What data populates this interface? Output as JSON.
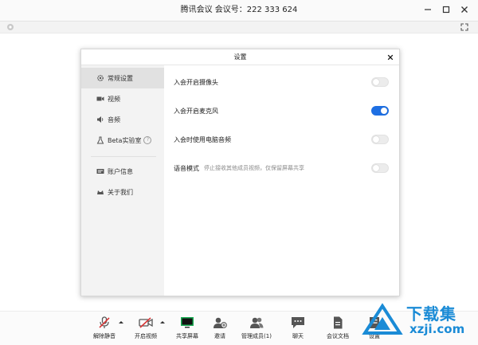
{
  "window": {
    "title": "腾讯会议  会议号：222 333 624"
  },
  "dialog": {
    "title": "设置",
    "nav": [
      {
        "label": "常规设置",
        "icon": "gear-icon"
      },
      {
        "label": "视频",
        "icon": "video-camera-icon"
      },
      {
        "label": "音频",
        "icon": "speaker-icon"
      },
      {
        "label": "Beta实验室",
        "icon": "flask-icon"
      },
      {
        "label": "账户信息",
        "icon": "id-card-icon"
      },
      {
        "label": "关于我们",
        "icon": "cat-icon"
      }
    ],
    "settings": [
      {
        "label": "入会开启摄像头",
        "note": "",
        "on": false
      },
      {
        "label": "入会开启麦克风",
        "note": "",
        "on": true
      },
      {
        "label": "入会时使用电脑音频",
        "note": "",
        "on": false
      },
      {
        "label": "语音模式",
        "note": "停止接收其他成员视频，仅保留屏幕共享",
        "on": false
      }
    ]
  },
  "bottom_toolbar": [
    {
      "label": "解除静音",
      "icon": "microphone-muted-icon"
    },
    {
      "label": "开启视频",
      "icon": "video-off-icon"
    },
    {
      "label": "共享屏幕",
      "icon": "share-screen-icon"
    },
    {
      "label": "邀请",
      "icon": "invite-user-icon"
    },
    {
      "label": "管理成员(1)",
      "icon": "members-icon"
    },
    {
      "label": "聊天",
      "icon": "chat-icon"
    },
    {
      "label": "会议文档",
      "icon": "document-icon"
    },
    {
      "label": "设置",
      "icon": "settings-icon"
    }
  ],
  "watermark": {
    "text": "下载集",
    "url": "xzji.com"
  },
  "colors": {
    "accent": "#1e6fe3",
    "muted_red": "#d93838",
    "share_green": "#1aad54"
  }
}
